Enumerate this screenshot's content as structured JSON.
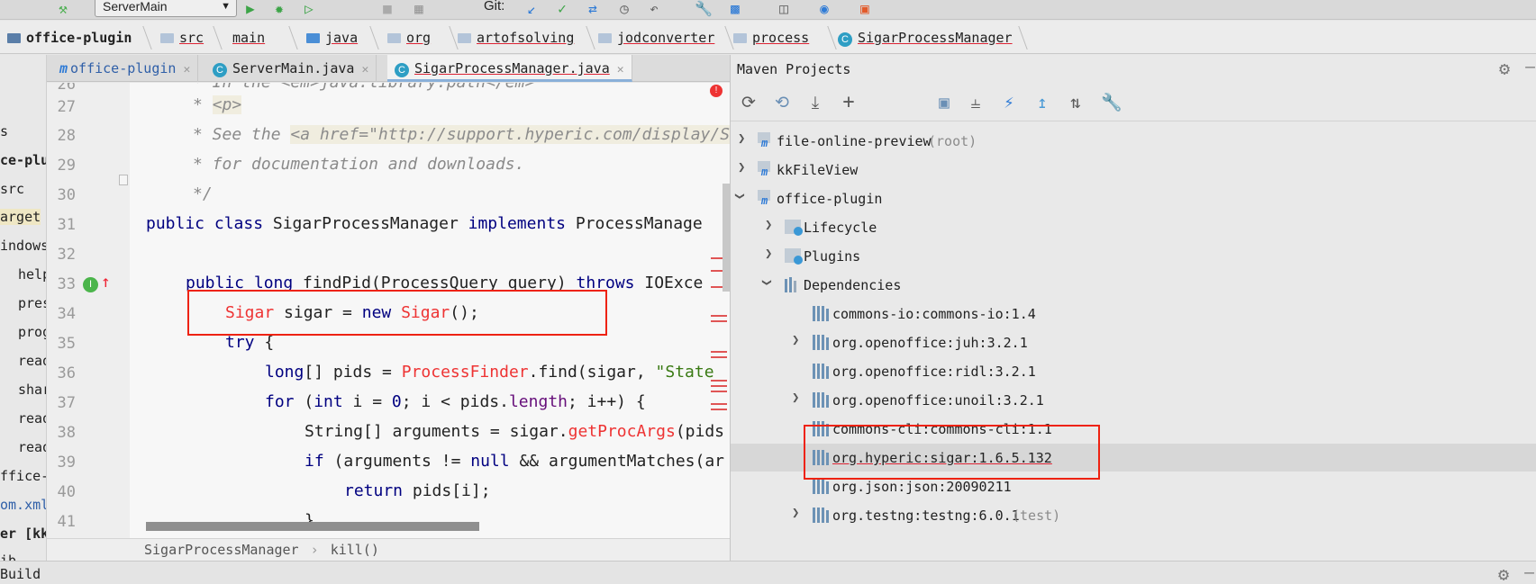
{
  "toolbar": {
    "run_config": "ServerMain",
    "git_label": "Git:"
  },
  "breadcrumb": {
    "project": "office-plugin",
    "items": [
      "src",
      "main",
      "java",
      "org",
      "artofsolving",
      "jodconverter",
      "process",
      "SigarProcessManager"
    ]
  },
  "project_strip": {
    "items": [
      "s",
      "ce-plu",
      "src",
      "arget",
      "indows",
      "help",
      "pres",
      "prog",
      "read",
      "shar",
      "read",
      "read",
      "ffice-",
      "om.xml",
      "er [kk",
      "ib"
    ]
  },
  "editor_tabs": [
    {
      "label": "office-plugin",
      "icon": "maven-module-icon"
    },
    {
      "label": "ServerMain.java",
      "icon": "java-class-icon"
    },
    {
      "label": "SigarProcessManager.java",
      "icon": "java-class-icon",
      "active": true
    }
  ],
  "editor": {
    "line_numbers": [
      "26",
      "27",
      "28",
      "29",
      "30",
      "31",
      "32",
      "33",
      "34",
      "35",
      "36",
      "37",
      "38",
      "39",
      "40",
      "41"
    ],
    "lines": {
      "l26": "* In the <em>java.library.path</em>",
      "l27_star": "* ",
      "l27_tag": "<p>",
      "l28_a": "* See the ",
      "l28_b": "<a href=\"http://support.hyperic.com/display/SIG",
      "l29": "* for documentation and downloads.",
      "l30": "*/",
      "l31_kw": "public class",
      "l31_name": " SigarProcessManager ",
      "l31_kw2": "implements",
      "l31_rest": " ProcessManage",
      "l33_kw": "public long",
      "l33_rest": " findPid(ProcessQuery query) ",
      "l33_kw2": "throws",
      "l33_rest2": " IOExce",
      "l34_type": "Sigar",
      "l34_mid": " sigar = ",
      "l34_kw": "new",
      "l34_ctor": " Sigar",
      "l34_end": "();",
      "l35_kw": "try",
      "l35_rest": " {",
      "l36_kw": "long",
      "l36_a": "[] pids = ",
      "l36_cls": "ProcessFinder",
      "l36_b": ".find(sigar, ",
      "l36_str": "\"State",
      "l37_kw": "for",
      "l37_a": " (",
      "l37_kw2": "int",
      "l37_b": " i = ",
      "l37_num": "0",
      "l37_c": "; i < pids.",
      "l37_fld": "length",
      "l37_d": "; i++) {",
      "l38_a": "String[] arguments = sigar.",
      "l38_m": "getProcArgs",
      "l38_b": "(pids",
      "l39_kw": "if",
      "l39_a": " (arguments != ",
      "l39_kw2": "null",
      "l39_b": " && argumentMatches(ar",
      "l40_kw": "return",
      "l40_a": " pids[i];",
      "l41": "}"
    },
    "gutter_badge": "I",
    "footer_class": "SigarProcessManager",
    "footer_sep": "›",
    "footer_method": "kill()"
  },
  "maven": {
    "title": "Maven Projects",
    "tree": [
      {
        "label": "file-online-preview",
        "suffix": "(root)",
        "level": 0,
        "expanded": false,
        "kind": "module"
      },
      {
        "label": "kkFileView",
        "suffix": "",
        "level": 0,
        "expanded": false,
        "kind": "module"
      },
      {
        "label": "office-plugin",
        "suffix": "",
        "level": 0,
        "expanded": true,
        "kind": "module"
      },
      {
        "label": "Lifecycle",
        "suffix": "",
        "level": 1,
        "expanded": false,
        "kind": "folder"
      },
      {
        "label": "Plugins",
        "suffix": "",
        "level": 1,
        "expanded": false,
        "kind": "folder"
      },
      {
        "label": "Dependencies",
        "suffix": "",
        "level": 1,
        "expanded": true,
        "kind": "deps"
      },
      {
        "label": "commons-io:commons-io:1.4",
        "suffix": "",
        "level": 2,
        "kind": "lib"
      },
      {
        "label": "org.openoffice:juh:3.2.1",
        "suffix": "",
        "level": 2,
        "expanded": false,
        "kind": "lib"
      },
      {
        "label": "org.openoffice:ridl:3.2.1",
        "suffix": "",
        "level": 2,
        "kind": "lib"
      },
      {
        "label": "org.openoffice:unoil:3.2.1",
        "suffix": "",
        "level": 2,
        "expanded": false,
        "kind": "lib"
      },
      {
        "label": "commons-cli:commons-cli:1.1",
        "suffix": "",
        "level": 2,
        "kind": "lib"
      },
      {
        "label": "org.hyperic:sigar:1.6.5.132",
        "suffix": "",
        "level": 2,
        "kind": "lib",
        "selected": true
      },
      {
        "label": "org.json:json:20090211",
        "suffix": "",
        "level": 2,
        "kind": "lib"
      },
      {
        "label": "org.testng:testng:6.0.1",
        "suffix": "(test)",
        "level": 2,
        "expanded": false,
        "kind": "lib"
      }
    ]
  },
  "bottom": {
    "build_tab": "Build"
  },
  "colors": {
    "highlight_box": "#e22211",
    "keyword": "#000080",
    "error": "#e33333"
  }
}
